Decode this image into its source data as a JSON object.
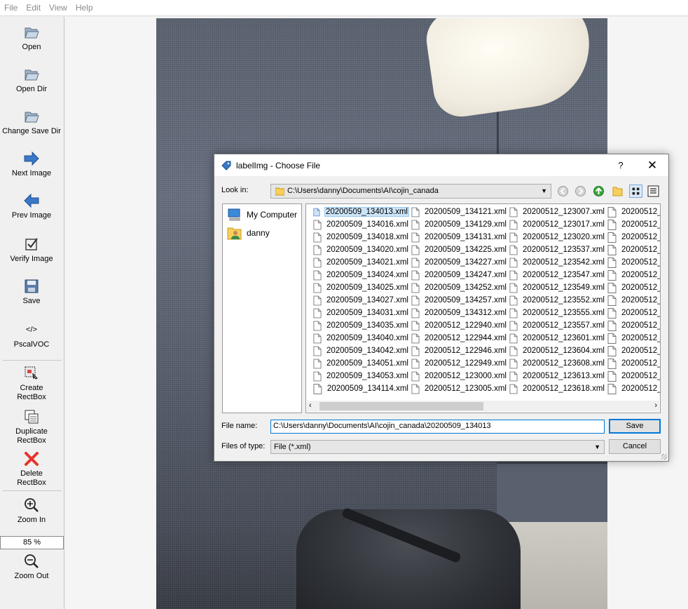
{
  "menu": [
    "File",
    "Edit",
    "View",
    "Help"
  ],
  "toolbar": {
    "open": "Open",
    "open_dir": "Open Dir",
    "change_save_dir": "Change Save Dir",
    "next_image": "Next Image",
    "prev_image": "Prev Image",
    "verify_image": "Verify Image",
    "save": "Save",
    "pascal_voc": "PscalVOC",
    "pascal_voc_icon": "</>",
    "create_rectbox": [
      "Create",
      "RectBox"
    ],
    "duplicate_rectbox": [
      "Duplicate",
      "RectBox"
    ],
    "delete_rectbox": [
      "Delete",
      "RectBox"
    ],
    "zoom_in": "Zoom In",
    "zoom_value": "85 %",
    "zoom_out": "Zoom Out"
  },
  "dialog": {
    "title": "labelImg - Choose File",
    "help": "?",
    "close": "✕",
    "look_in_label": "Look in:",
    "look_in_value": "C:\\Users\\danny\\Documents\\AI\\cojin_canada",
    "places": [
      "My Computer",
      "danny"
    ],
    "columns": [
      [
        "20200509_134013.xml",
        "20200509_134016.xml",
        "20200509_134018.xml",
        "20200509_134020.xml",
        "20200509_134021.xml",
        "20200509_134024.xml",
        "20200509_134025.xml",
        "20200509_134027.xml",
        "20200509_134031.xml",
        "20200509_134035.xml",
        "20200509_134040.xml",
        "20200509_134042.xml",
        "20200509_134051.xml",
        "20200509_134053.xml",
        "20200509_134114.xml"
      ],
      [
        "20200509_134121.xml",
        "20200509_134129.xml",
        "20200509_134131.xml",
        "20200509_134225.xml",
        "20200509_134227.xml",
        "20200509_134247.xml",
        "20200509_134252.xml",
        "20200509_134257.xml",
        "20200509_134312.xml",
        "20200512_122940.xml",
        "20200512_122944.xml",
        "20200512_122946.xml",
        "20200512_122949.xml",
        "20200512_123000.xml",
        "20200512_123005.xml"
      ],
      [
        "20200512_123007.xml",
        "20200512_123017.xml",
        "20200512_123020.xml",
        "20200512_123537.xml",
        "20200512_123542.xml",
        "20200512_123547.xml",
        "20200512_123549.xml",
        "20200512_123552.xml",
        "20200512_123555.xml",
        "20200512_123557.xml",
        "20200512_123601.xml",
        "20200512_123604.xml",
        "20200512_123608.xml",
        "20200512_123613.xml",
        "20200512_123618.xml"
      ],
      [
        "20200512_1",
        "20200512_1",
        "20200512_1",
        "20200512_1",
        "20200512_1",
        "20200512_1",
        "20200512_1",
        "20200512_1",
        "20200512_1",
        "20200512_1",
        "20200512_1",
        "20200512_1",
        "20200512_1",
        "20200512_1",
        "20200512_1"
      ]
    ],
    "selected_file": "20200509_134013.xml",
    "file_name_label": "File name:",
    "file_name_value": "C:\\Users\\danny\\Documents\\AI\\cojin_canada\\20200509_134013",
    "files_of_type_label": "Files of type:",
    "files_of_type_value": "File (*.xml)",
    "save_button": "Save",
    "cancel_button": "Cancel"
  },
  "colors": {
    "accent": "#0078d7",
    "selection": "#cce4f7",
    "delete_red": "#e8332b",
    "arrow_blue": "#3a78c9",
    "folder_yellow": "#f7cf5a"
  }
}
